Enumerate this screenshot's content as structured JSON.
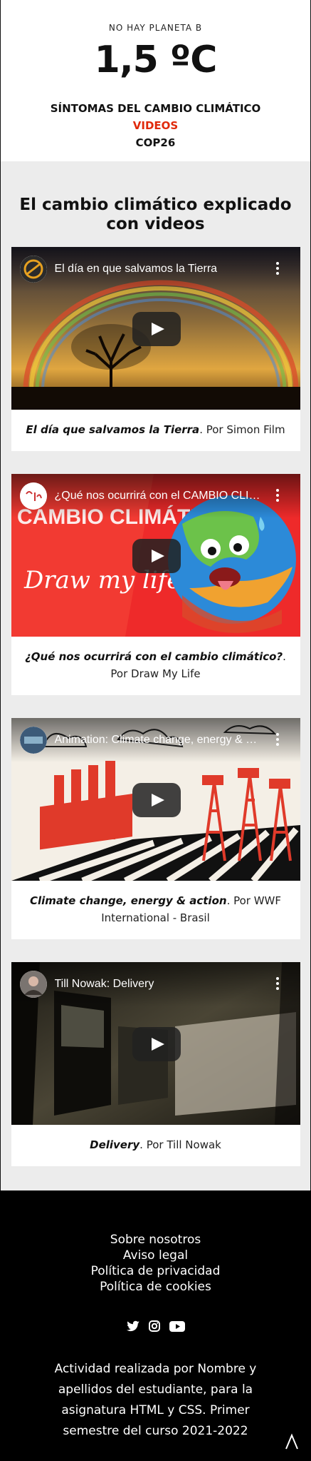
{
  "header": {
    "tagline": "NO HAY PLANETA B",
    "brand": "1,5 ºC",
    "nav": [
      "SÍNTOMAS DEL CAMBIO CLIMÁTICO",
      "VIDEOS",
      "COP26"
    ]
  },
  "main": {
    "section_title": "El cambio climático explicado con videos",
    "videos": [
      {
        "video_title": "El día en que salvamos la Tierra",
        "caption_title": "El día que salvamos la Tierra",
        "caption_author": ". Por Simon Film"
      },
      {
        "video_title": "¿Qué nos ocurrirá con el CAMBIO CLIMÁTICO?",
        "overlay_text": "CAMBIO CLIMÁTICO",
        "logo_text": "Draw my life",
        "caption_title": "¿Qué nos ocurrirá con el cambio climático?",
        "caption_author": ". Por Draw My Life"
      },
      {
        "video_title": "Animation: Climate change, energy & action",
        "caption_title": "Climate change, energy & action",
        "caption_author": ". Por WWF International - Brasil"
      },
      {
        "video_title": "Till Nowak: Delivery",
        "caption_title": "Delivery",
        "caption_author": ". Por Till Nowak"
      }
    ]
  },
  "footer": {
    "links": [
      "Sobre nosotros",
      "Aviso legal",
      "Política de privacidad",
      "Política de cookies"
    ],
    "social_icons": [
      "twitter-icon",
      "instagram-icon",
      "youtube-icon"
    ],
    "credits": "Actividad realizada por Nombre y apellidos del estudiante, para la asignatura HTML y CSS. Primer semestre del curso 2021-2022"
  },
  "colors": {
    "accent": "#e0290a",
    "footer_bg": "#000000",
    "page_bg": "#ececec"
  }
}
